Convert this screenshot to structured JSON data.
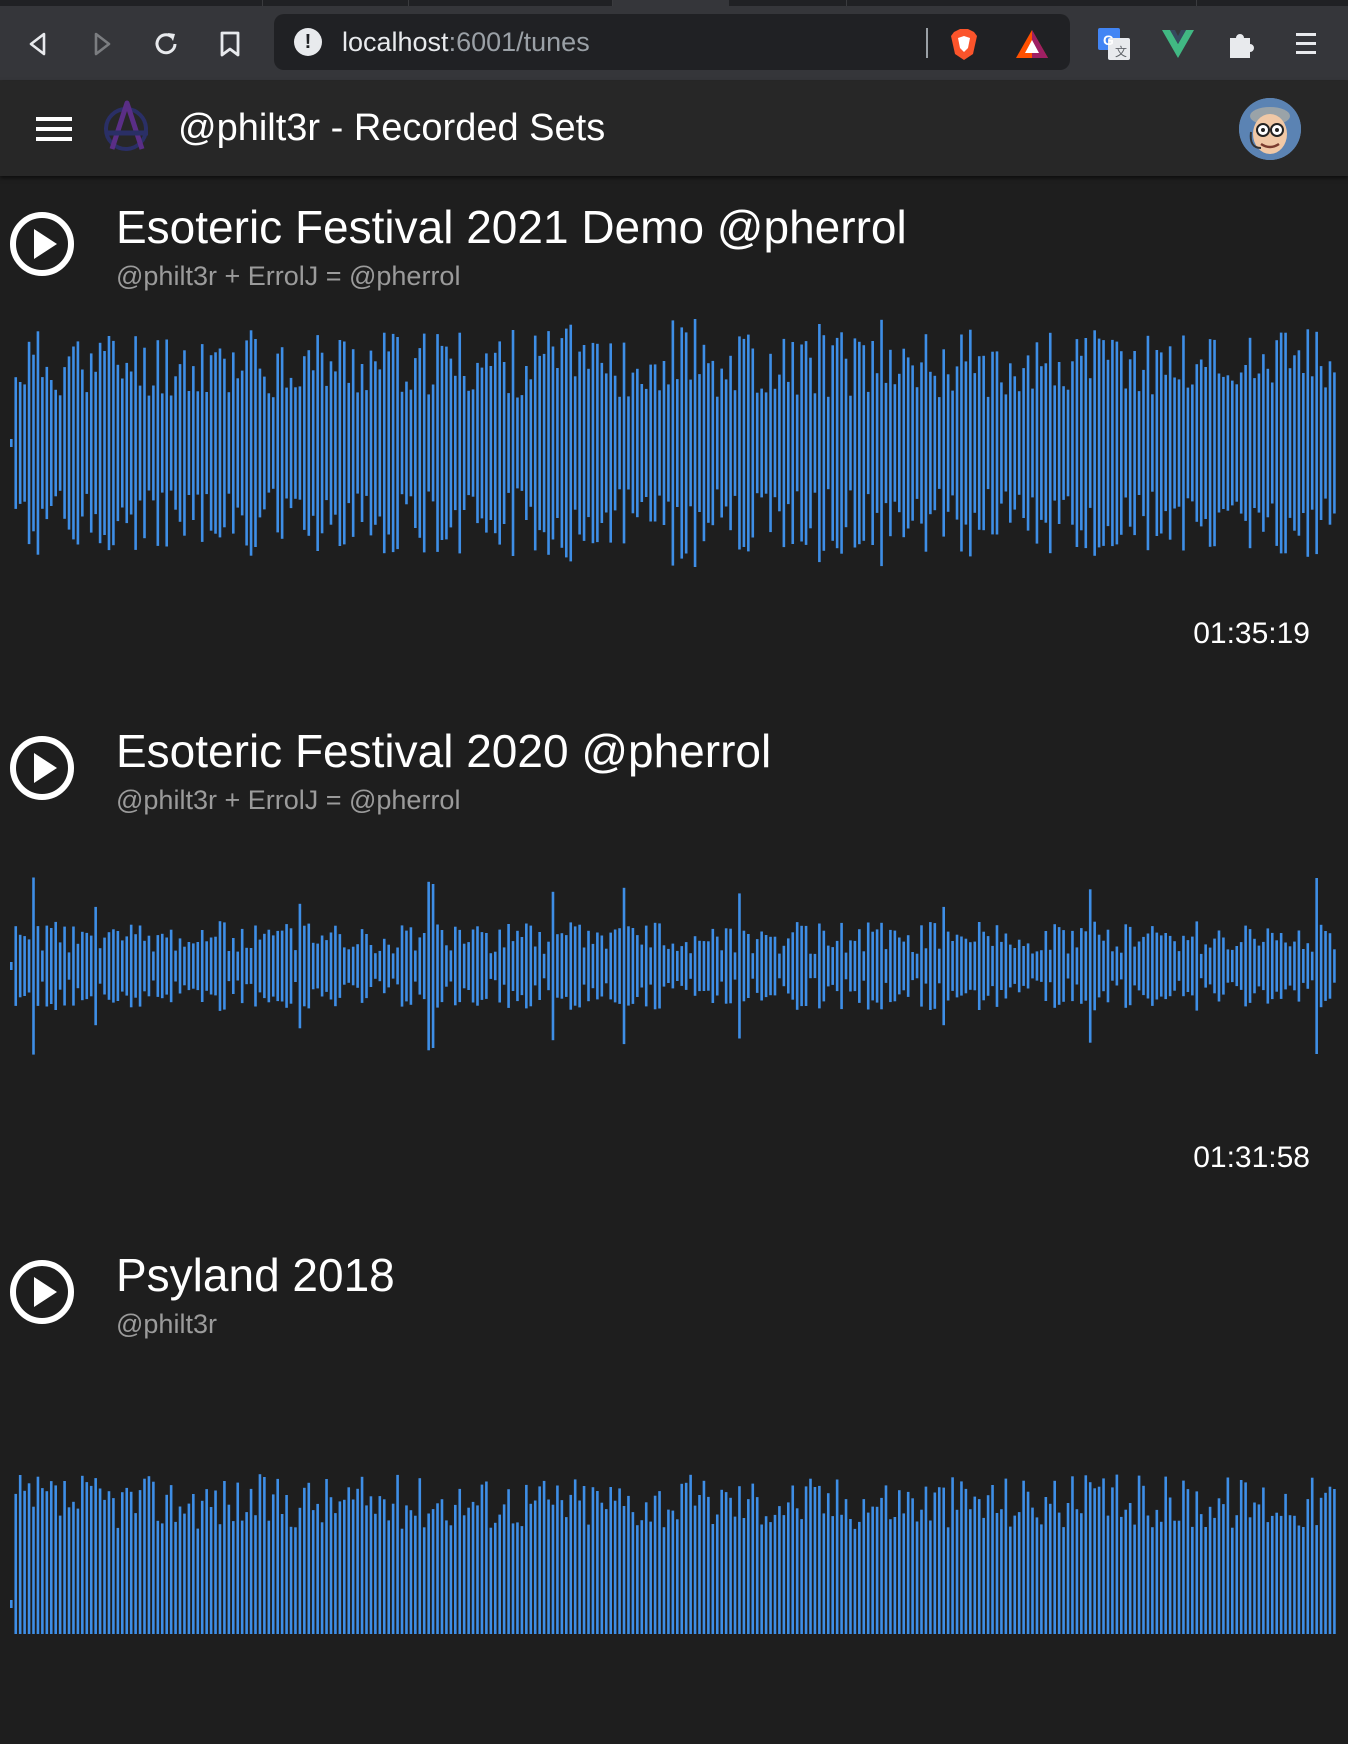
{
  "browser": {
    "url_host": "localhost",
    "url_rest": ":6001/tunes",
    "extensions": [
      "brave-shield-icon",
      "brave-rewards-icon",
      "google-translate-icon",
      "vue-devtools-icon",
      "extensions-puzzle-icon",
      "reading-list-icon"
    ]
  },
  "appbar": {
    "title": "@philt3r - Recorded Sets"
  },
  "colors": {
    "background": "#1e1e1e",
    "waveform": "#3e8ee6",
    "subtitle": "#9b9b9b"
  },
  "tracks": [
    {
      "title": "Esoteric Festival 2021 Demo @pherrol",
      "artist": "@philt3r + ErrolJ = @pherrol",
      "duration": "01:35:19"
    },
    {
      "title": "Esoteric Festival 2020 @pherrol",
      "artist": "@philt3r + ErrolJ = @pherrol",
      "duration": "01:31:58"
    },
    {
      "title": "Psyland 2018",
      "artist": "@philt3r",
      "duration": ""
    }
  ]
}
